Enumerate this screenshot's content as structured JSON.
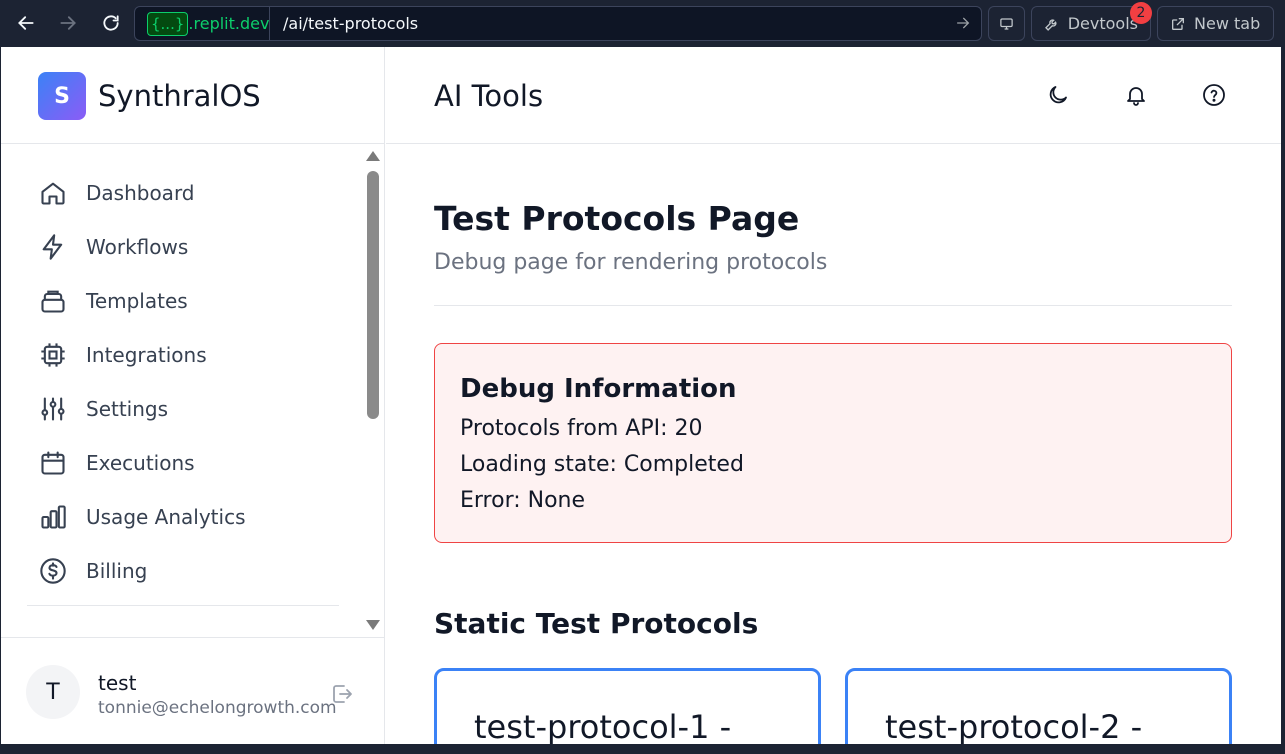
{
  "browser": {
    "host_braces": "{...}",
    "host": ".replit.dev",
    "path": "/ai/test-protocols",
    "devtools_label": "Devtools",
    "devtools_badge": "2",
    "newtab_label": "New tab"
  },
  "sidebar": {
    "logo_letter": "S",
    "brand": "SynthralOS",
    "items": [
      {
        "label": "Dashboard",
        "icon": "home-icon"
      },
      {
        "label": "Workflows",
        "icon": "lightning-icon"
      },
      {
        "label": "Templates",
        "icon": "layers-icon"
      },
      {
        "label": "Integrations",
        "icon": "chip-icon"
      },
      {
        "label": "Settings",
        "icon": "sliders-icon"
      },
      {
        "label": "Executions",
        "icon": "calendar-icon"
      },
      {
        "label": "Usage Analytics",
        "icon": "bar-chart-icon"
      },
      {
        "label": "Billing",
        "icon": "dollar-circle-icon"
      }
    ],
    "user": {
      "initial": "T",
      "name": "test",
      "email": "tonnie@echelongrowth.com"
    }
  },
  "header": {
    "title": "AI Tools"
  },
  "main": {
    "title": "Test Protocols Page",
    "subtitle": "Debug page for rendering protocols",
    "debug": {
      "title": "Debug Information",
      "protocols": "Protocols from API: 20",
      "loading": "Loading state: Completed",
      "error": "Error: None"
    },
    "static_title": "Static Test Protocols",
    "cards": [
      {
        "title": "test-protocol-1 -"
      },
      {
        "title": "test-protocol-2 -"
      }
    ]
  },
  "colors": {
    "accent": "#3b82f6",
    "debug_border": "#ef4444",
    "debug_bg": "#fef2f2"
  }
}
